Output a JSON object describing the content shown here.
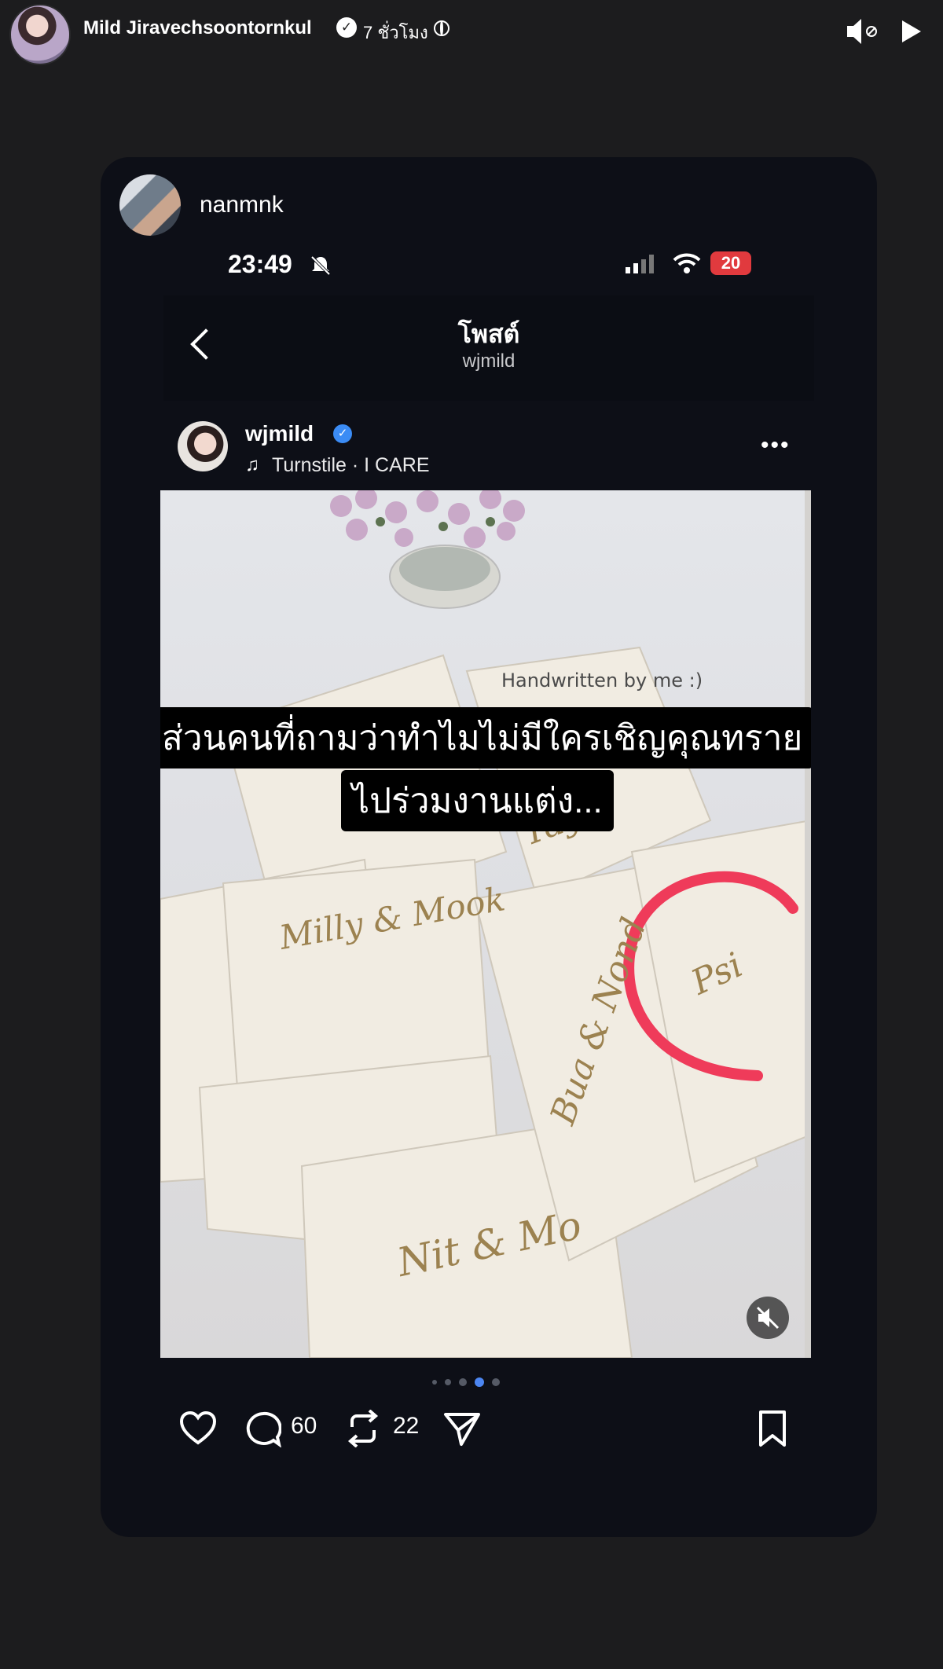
{
  "story": {
    "author": "Mild Jiravechsoontornkul",
    "time": "7 ชั่วโมง",
    "privacy_icon": "globe-icon"
  },
  "card": {
    "sharer": "nanmnk",
    "status": {
      "time": "23:49",
      "battery": "20"
    },
    "nav": {
      "title": "โพสต์",
      "subtitle": "wjmild"
    },
    "post": {
      "username": "wjmild",
      "music": "Turnstile · I CARE",
      "more": "•••",
      "photo_text": "Handwritten by me :)",
      "caption_line1": "ส่วนคนที่ถามว่าทำไมไม่มีใครเชิญคุณทราย",
      "caption_line2": "ไปร่วมงานแต่ง...",
      "envelope_names": [
        "Milly & Mook",
        "Bua & Nond",
        "Nit & Mo",
        "Tay",
        "Psi"
      ]
    },
    "actions": {
      "comments": "60",
      "reposts": "22"
    },
    "carousel": {
      "count": 5,
      "active": 3
    }
  },
  "colors": {
    "accent_red": "#ef3b5a",
    "verified_blue": "#3b8cf5",
    "card_bg": "#0d0f17"
  }
}
